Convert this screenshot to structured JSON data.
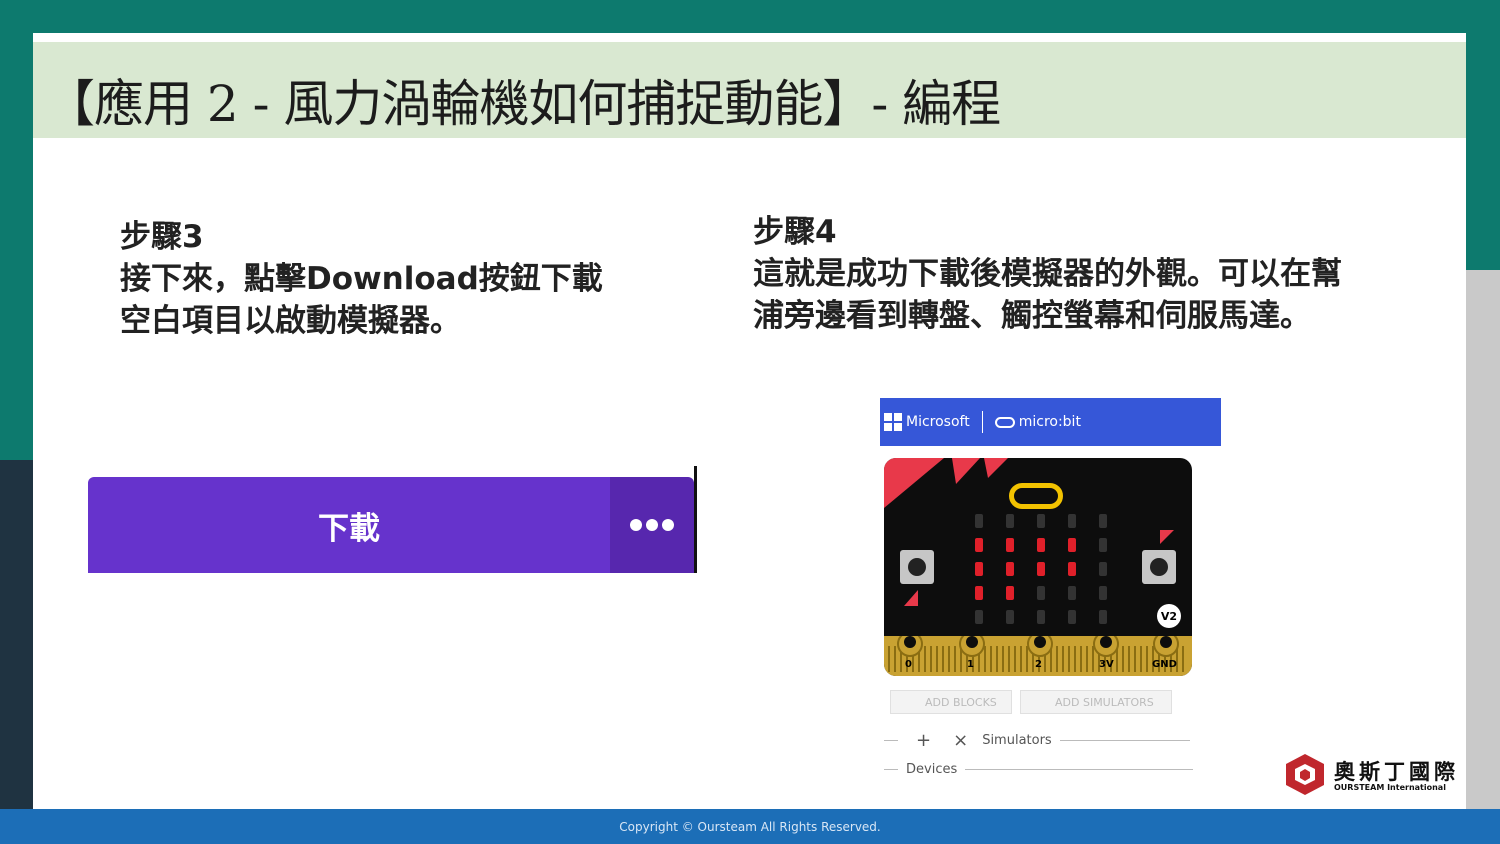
{
  "slide": {
    "title": "【應用 2 - 風力渦輪機如何捕捉動能】- 編程"
  },
  "step3": {
    "heading": "步驟3",
    "lines": [
      "接下來，點擊Download按鈕下載",
      "空白項目以啟動模擬器。"
    ]
  },
  "step4": {
    "heading": "步驟4",
    "lines": [
      "這就是成功下載後模擬器的外觀。可以在幫",
      "浦旁邊看到轉盤、觸控螢幕和伺服馬達。"
    ]
  },
  "download_button": {
    "label": "下載",
    "color": "#6633cc"
  },
  "simulator": {
    "brand_microsoft": "Microsoft",
    "brand_microbit": "micro:bit",
    "header_color": "#3657d8",
    "badge": "V2",
    "pin_labels": [
      "0",
      "1",
      "2",
      "3V",
      "GND"
    ],
    "add_blocks": "ADD BLOCKS",
    "add_simulators": "ADD SIMULATORS",
    "plus": "+",
    "close": "×",
    "simulators_label": "Simulators",
    "devices_label": "Devices"
  },
  "brand": {
    "name": "奧斯丁國際",
    "sub": "OURSTEAM International"
  },
  "footer": {
    "copyright": "Copyright © Oursteam All Rights Reserved."
  },
  "colors": {
    "teal_background": "#0d7a6e",
    "title_bar": "#d9e8d1",
    "footer": "#1c6eb7"
  }
}
